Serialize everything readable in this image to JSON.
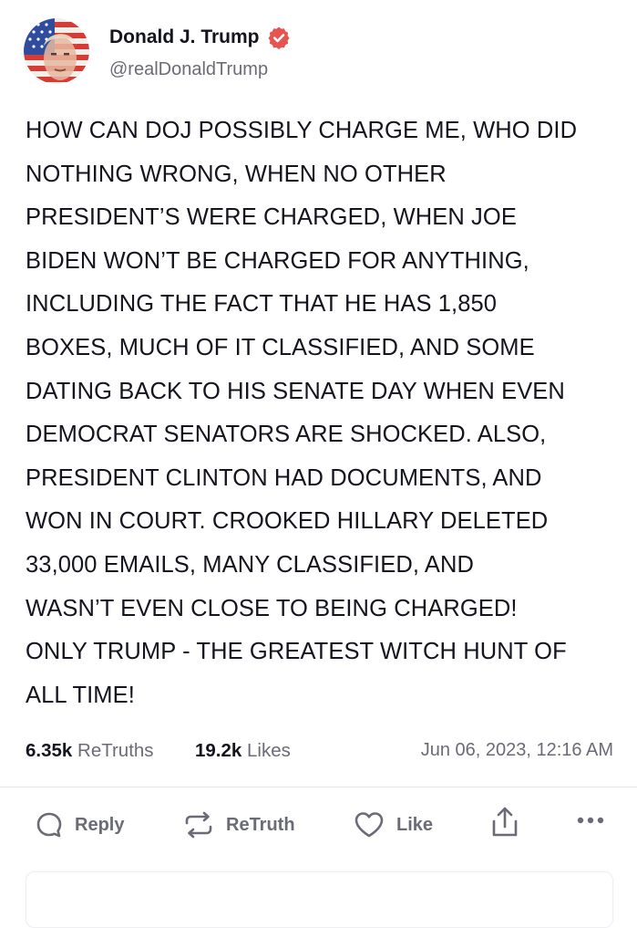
{
  "author": {
    "display_name": "Donald J. Trump",
    "handle": "@realDonaldTrump",
    "verified": true,
    "avatar_icon": "flag-portrait-avatar"
  },
  "post": {
    "text": "HOW CAN DOJ POSSIBLY CHARGE ME, WHO DID\nNOTHING WRONG, WHEN NO OTHER\nPRESIDENT’S WERE CHARGED, WHEN JOE\nBIDEN WON’T BE CHARGED FOR ANYTHING,\nINCLUDING THE FACT THAT HE HAS 1,850\nBOXES, MUCH OF IT CLASSIFIED, AND SOME\nDATING BACK TO HIS SENATE DAY WHEN EVEN\nDEMOCRAT SENATORS ARE SHOCKED. ALSO,\nPRESIDENT CLINTON HAD DOCUMENTS, AND\nWON IN COURT. CROOKED HILLARY DELETED\n33,000 EMAILS, MANY CLASSIFIED, AND\nWASN’T EVEN CLOSE TO BEING CHARGED!\nONLY TRUMP - THE GREATEST WITCH HUNT OF\nALL TIME!"
  },
  "stats": {
    "retruths_count": "6.35k",
    "retruths_label": "ReTruths",
    "likes_count": "19.2k",
    "likes_label": "Likes",
    "timestamp": "Jun 06, 2023, 12:16 AM"
  },
  "actions": {
    "reply_label": "Reply",
    "retruth_label": "ReTruth",
    "like_label": "Like"
  },
  "colors": {
    "text": "#14141f",
    "muted": "#6b6b78",
    "verified": "#e5544f",
    "divider": "#e7e7ee"
  }
}
